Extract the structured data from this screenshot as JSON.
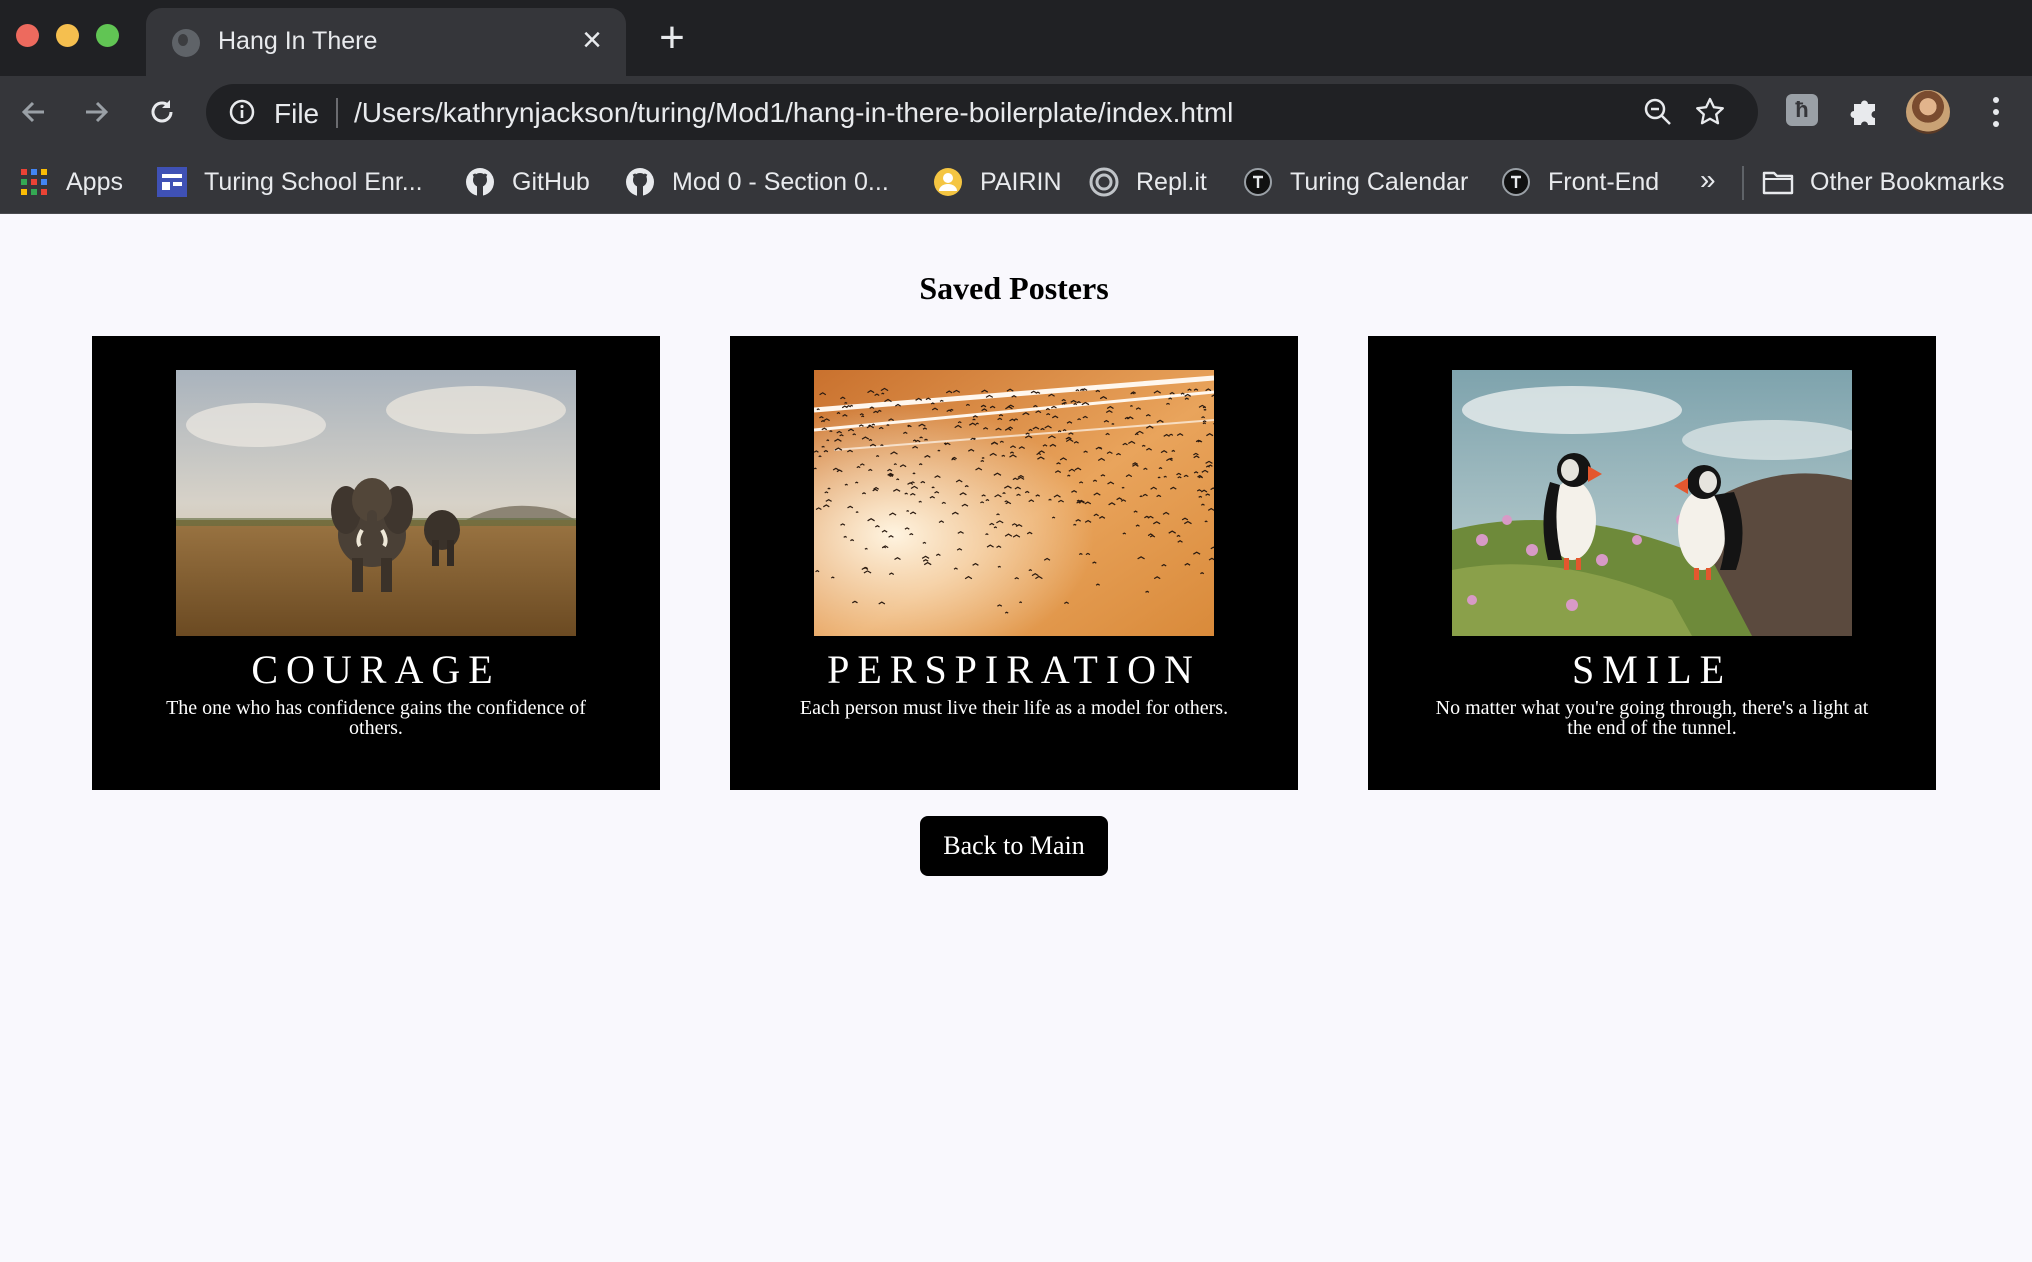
{
  "browser": {
    "tab": {
      "title": "Hang In There",
      "close_glyph": "×"
    },
    "new_tab_glyph": "+",
    "omnibox": {
      "scheme": "File",
      "url": "/Users/kathrynjackson/turing/Mod1/hang-in-there-boilerplate/index.html"
    },
    "extension_glyph": "ħ",
    "bookmarks": [
      {
        "label": "Apps",
        "icon": "apps-grid-icon"
      },
      {
        "label": "Turing School Enr...",
        "icon": "form-icon"
      },
      {
        "label": "GitHub",
        "icon": "github-icon"
      },
      {
        "label": "Mod 0 - Section 0...",
        "icon": "github-icon"
      },
      {
        "label": "PAIRIN",
        "icon": "pairin-icon"
      },
      {
        "label": "Repl.it",
        "icon": "replit-icon"
      },
      {
        "label": "Turing Calendar",
        "icon": "turing-icon"
      },
      {
        "label": "Front-End",
        "icon": "turing-icon"
      }
    ],
    "overflow_glyph": "»",
    "other_bookmarks": "Other Bookmarks",
    "colors": {
      "frame": "#202124",
      "toolbar": "#35363a",
      "text": "#e8eaed"
    }
  },
  "page": {
    "title": "Saved Posters",
    "posters": [
      {
        "title": "COURAGE",
        "quote": "The one who has confidence gains the confidence of others.",
        "image": "elephants-savanna"
      },
      {
        "title": "PERSPIRATION",
        "quote": "Each person must live their life as a model for others.",
        "image": "bird-flock-sunset"
      },
      {
        "title": "SMILE",
        "quote": "No matter what you're going through, there's a light at the end of the tunnel.",
        "image": "puffins-cliff"
      }
    ],
    "back_button": "Back to Main",
    "colors": {
      "background": "#f9f8fd",
      "poster": "#000000",
      "button": "#000000"
    }
  }
}
